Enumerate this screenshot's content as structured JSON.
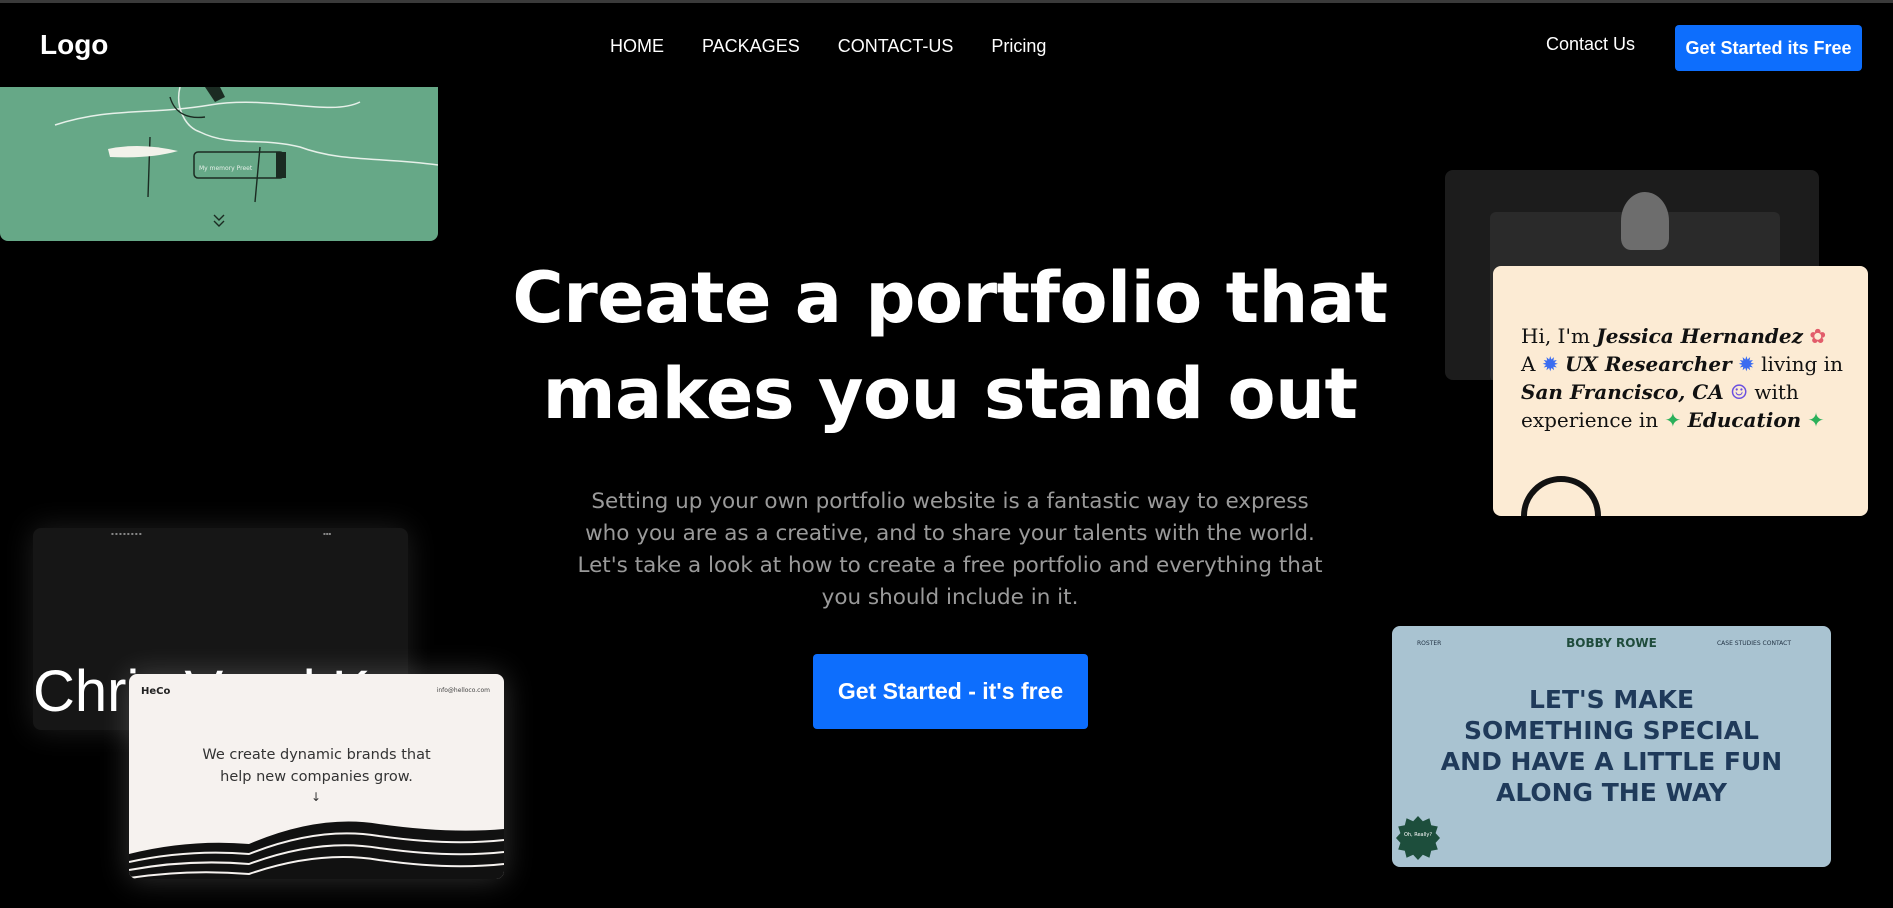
{
  "nav": {
    "logo": "Logo",
    "menu": [
      "HOME",
      "PACKAGES",
      "CONTACT-US",
      "Pricing"
    ],
    "contact": "Contact Us",
    "cta": "Get Started its Free"
  },
  "hero": {
    "title_line1": "Create a portfolio that",
    "title_line2": "makes you stand out",
    "subtitle": "Setting up your own portfolio website is a fantastic way to express who you are as a creative, and to share your talents with the world. Let's take a look at how to create a free portfolio and everything that you should include in it.",
    "cta": "Get Started - it's free"
  },
  "cards": {
    "green": {
      "label": "My memory Preet"
    },
    "dark": {
      "big_text": "Chris Vaed Keu th"
    },
    "hello": {
      "logo": "HeCo",
      "email": "info@helloco.com",
      "line1": "We create dynamic brands that",
      "line2": "help new companies grow.",
      "arrow": "↓"
    },
    "jessica": {
      "p1": "Hi, I'm ",
      "name": "Jessica Hernandez",
      "p2": "A ",
      "role": "UX Researcher",
      "p3": " living in",
      "city": "San Francisco, CA",
      "p4": " with",
      "p5": "experience in ",
      "field": "Education"
    },
    "bobby": {
      "left": "ROSTER",
      "name": "BOBBY ROWE",
      "right": "CASE STUDIES   CONTACT",
      "line1": "LET'S MAKE",
      "line2": "SOMETHING SPECIAL",
      "line3": "AND HAVE A LITTLE FUN",
      "line4": "ALONG THE WAY",
      "badge": "Oh, Really?"
    }
  },
  "colors": {
    "accent": "#0d6efd",
    "background": "#000000",
    "muted_text": "#9a9a9a"
  }
}
